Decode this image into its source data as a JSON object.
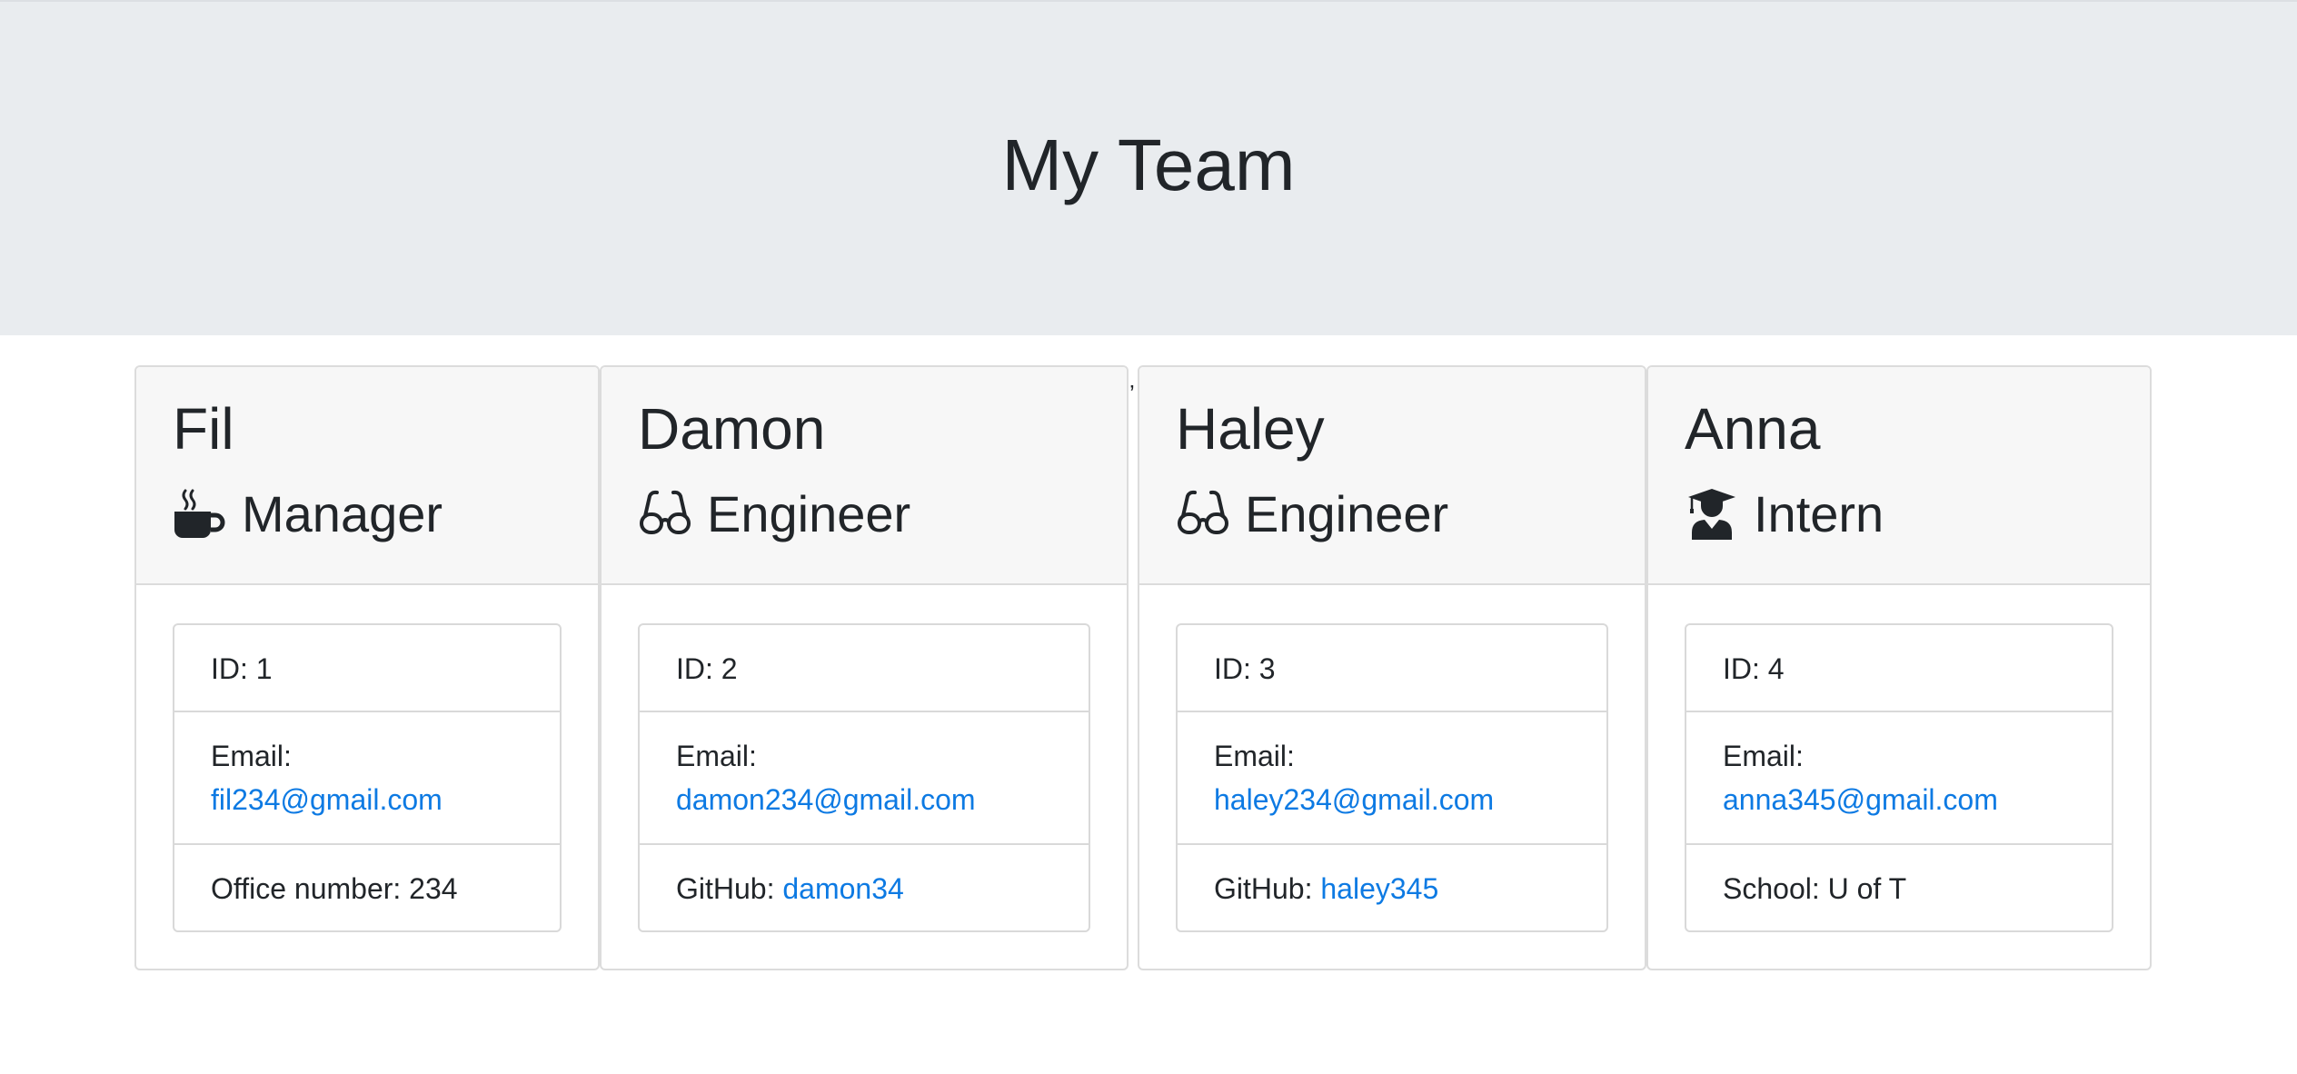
{
  "header": {
    "title": "My Team"
  },
  "stray_mark": "’",
  "colors": {
    "header_bg": "#e9ecef",
    "card_header_bg": "#f7f7f7",
    "link": "#0d7ae3",
    "text": "#212529"
  },
  "team": [
    {
      "name": "Fil",
      "role": "Manager",
      "role_icon": "mug-hot-icon",
      "id_text": "ID: 1",
      "email_label": "Email:",
      "email": "fil234@gmail.com",
      "extra_label": "Office number: 234",
      "extra_link": ""
    },
    {
      "name": "Damon",
      "role": "Engineer",
      "role_icon": "glasses-icon",
      "id_text": "ID: 2",
      "email_label": "Email:",
      "email": "damon234@gmail.com",
      "extra_label": "GitHub: ",
      "extra_link": "damon34"
    },
    {
      "name": "Haley",
      "role": "Engineer",
      "role_icon": "glasses-icon",
      "id_text": "ID: 3",
      "email_label": "Email:",
      "email": "haley234@gmail.com",
      "extra_label": "GitHub: ",
      "extra_link": "haley345"
    },
    {
      "name": "Anna",
      "role": "Intern",
      "role_icon": "user-graduate-icon",
      "id_text": "ID: 4",
      "email_label": "Email:",
      "email": "anna345@gmail.com",
      "extra_label": "School: U of T",
      "extra_link": ""
    }
  ]
}
